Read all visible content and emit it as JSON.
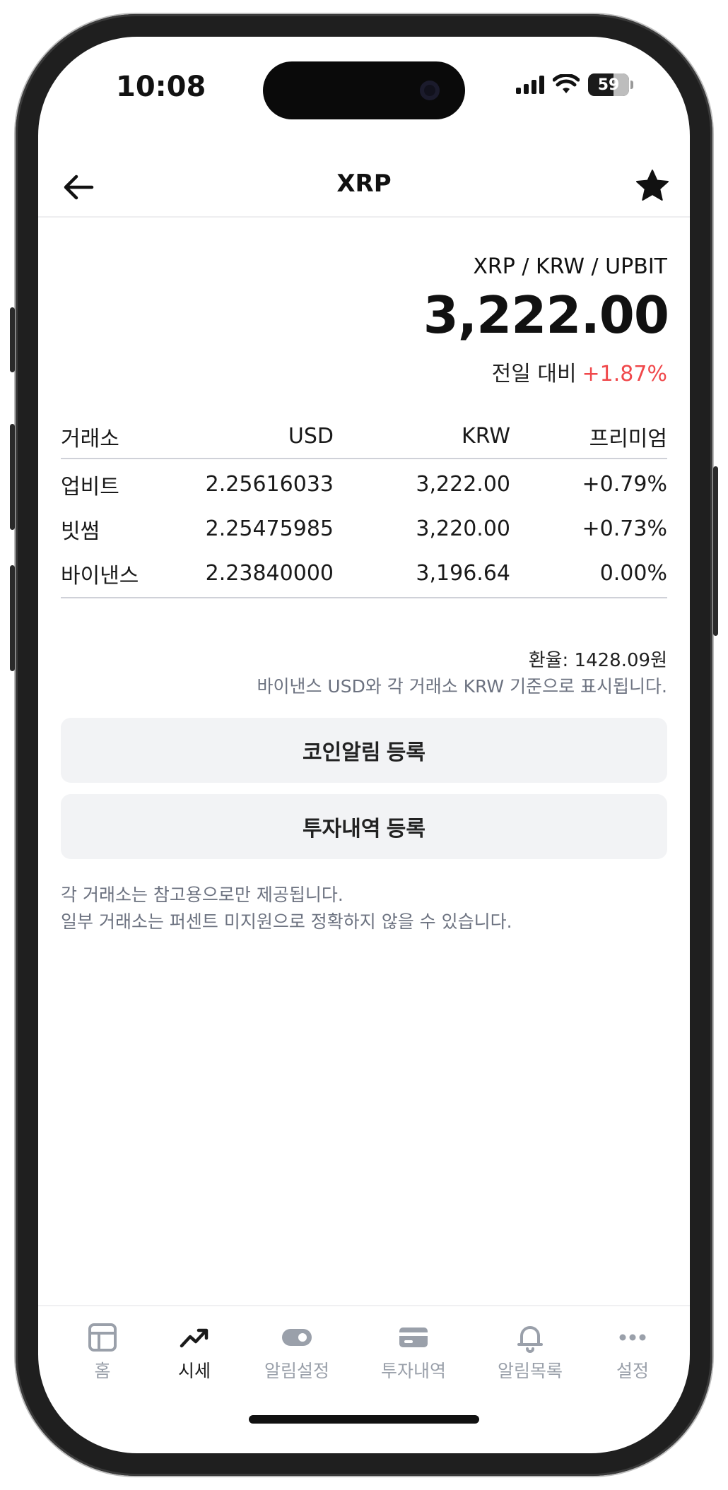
{
  "status_bar": {
    "time": "10:08",
    "battery": "59"
  },
  "header": {
    "title": "XRP",
    "back_icon": "arrow-left-icon",
    "favorite_icon": "star-icon"
  },
  "quote": {
    "pair": "XRP / KRW / UPBIT",
    "price": "3,222.00",
    "change_label": "전일 대비",
    "change_value": "+1.87%",
    "change_color": "#f0484b"
  },
  "exchange_table": {
    "columns": [
      "거래소",
      "USD",
      "KRW",
      "프리미엄"
    ],
    "rows": [
      {
        "exchange": "업비트",
        "usd": "2.25616033",
        "krw": "3,222.00",
        "premium": "+0.79%"
      },
      {
        "exchange": "빗썸",
        "usd": "2.25475985",
        "krw": "3,220.00",
        "premium": "+0.73%"
      },
      {
        "exchange": "바이낸스",
        "usd": "2.23840000",
        "krw": "3,196.64",
        "premium": "0.00%"
      }
    ]
  },
  "rate_info": {
    "exchange_rate": "환율: 1428.09원",
    "note": "바이낸스 USD와 각 거래소 KRW 기준으로 표시됩니다."
  },
  "actions": {
    "coin_alert_label": "코인알림 등록",
    "investment_label": "투자내역 등록"
  },
  "disclaimer": {
    "line1": "각 거래소는 참고용으로만 제공됩니다.",
    "line2": "일부 거래소는 퍼센트 미지원으로 정확하지 않을 수 있습니다."
  },
  "tabs": [
    {
      "label": "홈",
      "icon": "layout-icon"
    },
    {
      "label": "시세",
      "icon": "trending-up-icon",
      "active": true
    },
    {
      "label": "알림설정",
      "icon": "toggle-icon"
    },
    {
      "label": "투자내역",
      "icon": "card-icon"
    },
    {
      "label": "알림목록",
      "icon": "bell-icon"
    },
    {
      "label": "설정",
      "icon": "more-icon"
    }
  ]
}
